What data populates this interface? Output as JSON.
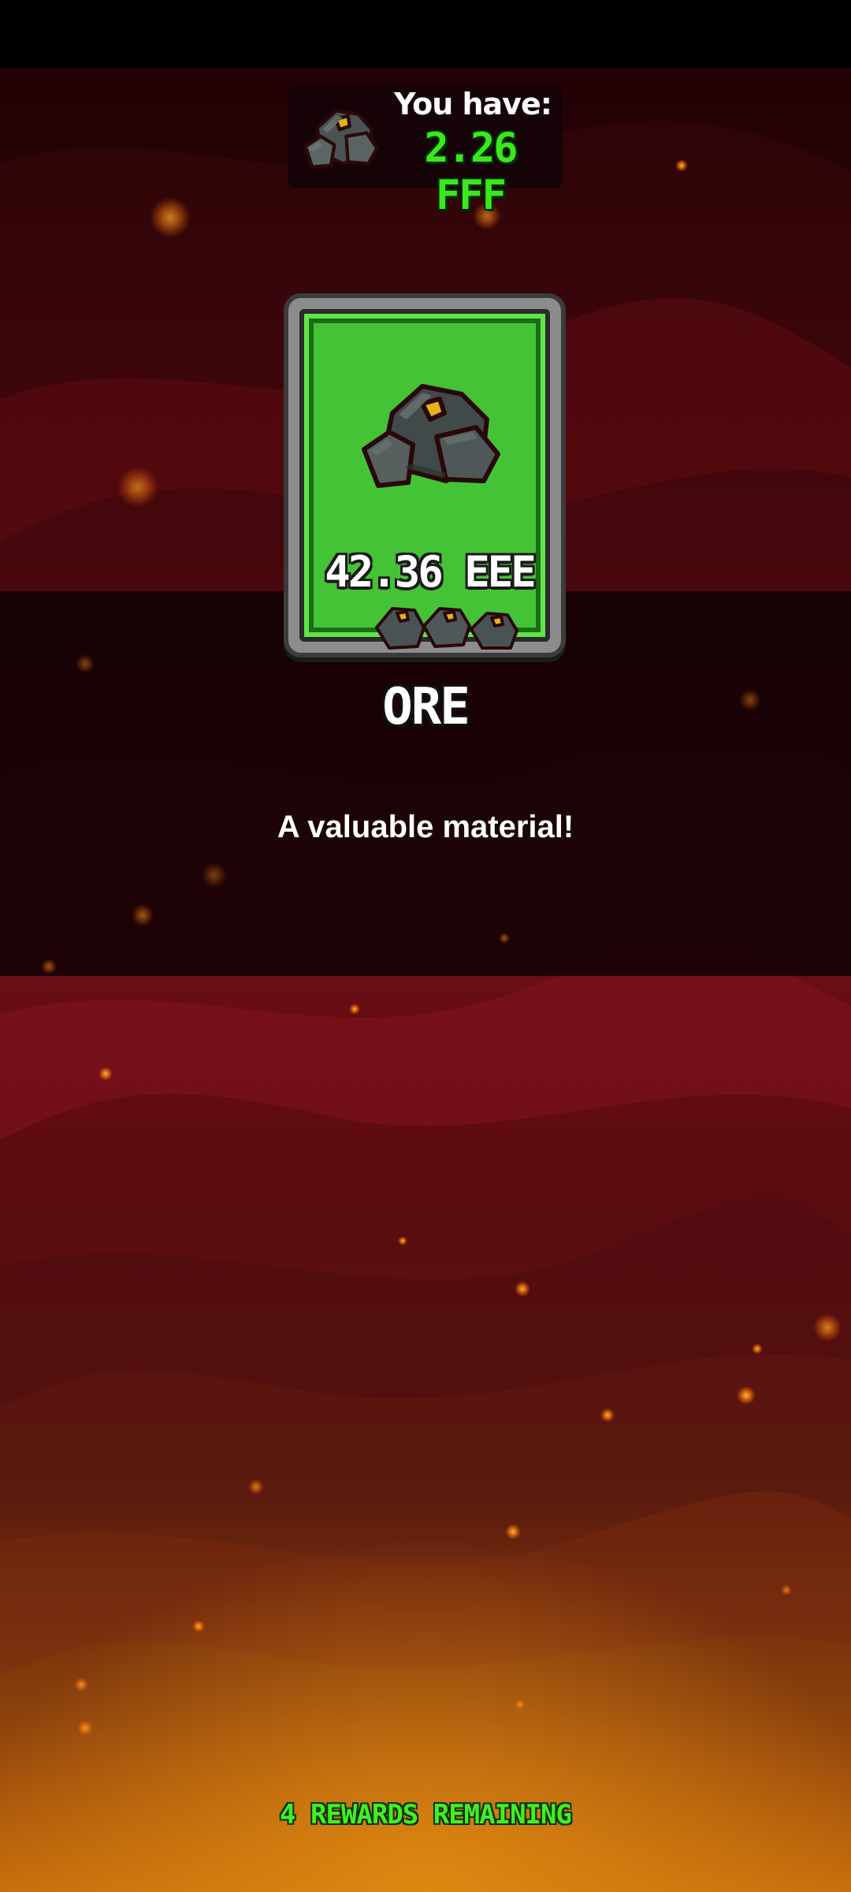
{
  "currency": {
    "label": "You have:",
    "value": "2.26 FFF",
    "icon": "ore-icon",
    "value_color": "#3be81d"
  },
  "reward_card": {
    "amount": "42.36 EEE",
    "icon": "ore-icon",
    "rarity_color": "#45c336"
  },
  "item": {
    "name": "ORE",
    "description": "A valuable material!"
  },
  "footer": {
    "rewards_remaining": "4 REWARDS REMAINING"
  },
  "theme": {
    "background_dark": "#2a0407",
    "background_red": "#7d1118",
    "background_glow": "#d0750e",
    "ember": "#ff9a1c"
  }
}
